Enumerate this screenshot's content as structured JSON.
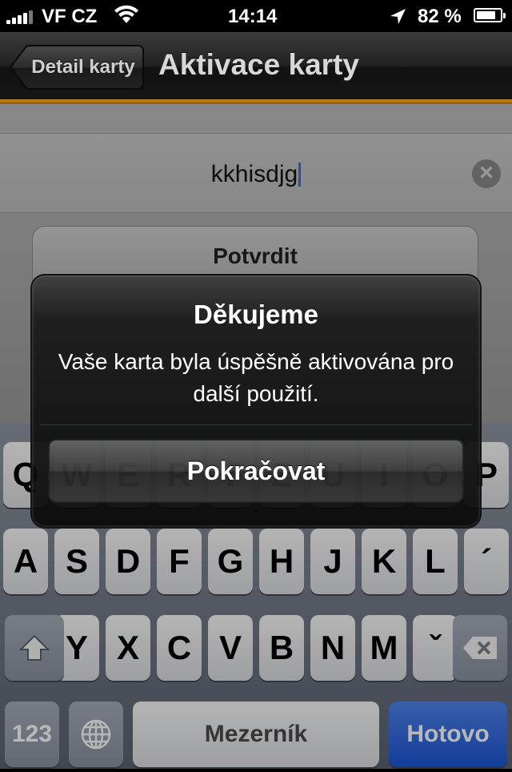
{
  "status_bar": {
    "carrier": "VF CZ",
    "time": "14:14",
    "battery": "82 %",
    "battery_level": 0.82,
    "signal_icon": "signal-bars-icon",
    "wifi_icon": "wifi-icon",
    "location_icon": "location-arrow-icon"
  },
  "nav": {
    "back_label": "Detail karty",
    "title": "Aktivace karty"
  },
  "form": {
    "field_value": "kkhisdjg",
    "clear_icon": "clear-icon",
    "confirm_label": "Potvrdit"
  },
  "alert": {
    "title": "Děkujeme",
    "message": "Vaše karta byla úspěšně aktivována pro další použití.",
    "button_label": "Pokračovat"
  },
  "keyboard": {
    "row1": [
      "Q",
      "W",
      "E",
      "R",
      "T",
      "Z",
      "U",
      "I",
      "O",
      "P"
    ],
    "row2": [
      "A",
      "S",
      "D",
      "F",
      "G",
      "H",
      "J",
      "K",
      "L",
      "´"
    ],
    "row3": [
      "Y",
      "X",
      "C",
      "V",
      "B",
      "N",
      "M",
      "ˇ"
    ],
    "shift_icon": "shift-icon",
    "delete_icon": "delete-icon",
    "numbers_label": "123",
    "globe_icon": "globe-icon",
    "space_label": "Mezerník",
    "return_label": "Hotovo",
    "return_color": "#1b56d6"
  }
}
